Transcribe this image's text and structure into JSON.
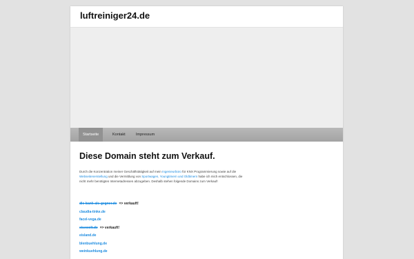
{
  "site": {
    "title": "luftreiniger24.de"
  },
  "nav": {
    "items": [
      {
        "label": "Startseite",
        "active": true
      },
      {
        "label": "Kontakt",
        "active": false
      },
      {
        "label": "Impressum",
        "active": false
      }
    ]
  },
  "main": {
    "heading": "Diese Domain steht zum Verkauf.",
    "intro": {
      "p1": "Durch die Konzentration meiner Geschäftstätigkeit auf mein ",
      "link_ingenieur": "Ingenieurbüro",
      "p2": " für KNX Programmierung sowie auf die ",
      "link_webseiten": "Webseitenerstellung",
      "p3": " und die Vermittlung von ",
      "link_sportwagen": "Sportwagen, Youngtimern und Oldtimern",
      "p4": " habe ich mich entschlossen, die nicht mehr benötigten Internetadressen abzugeben. Deshalb stehen folgende Domains zum Verkauf!"
    },
    "domains": [
      {
        "name": "die-bank-als-gegner.de",
        "sold": true,
        "note": "=> verkauft!"
      },
      {
        "name": "claudia-tinke.de",
        "sold": false,
        "note": ""
      },
      {
        "name": "facel-vega.de",
        "sold": false,
        "note": ""
      },
      {
        "name": "eisewelt.de",
        "sold": true,
        "note": "=> verkauft!"
      },
      {
        "name": "eisland.de",
        "sold": false,
        "note": ""
      },
      {
        "name": "blenbuehlung.de",
        "sold": false,
        "note": ""
      },
      {
        "name": "weinkuehlung.de",
        "sold": false,
        "note": ""
      }
    ]
  }
}
